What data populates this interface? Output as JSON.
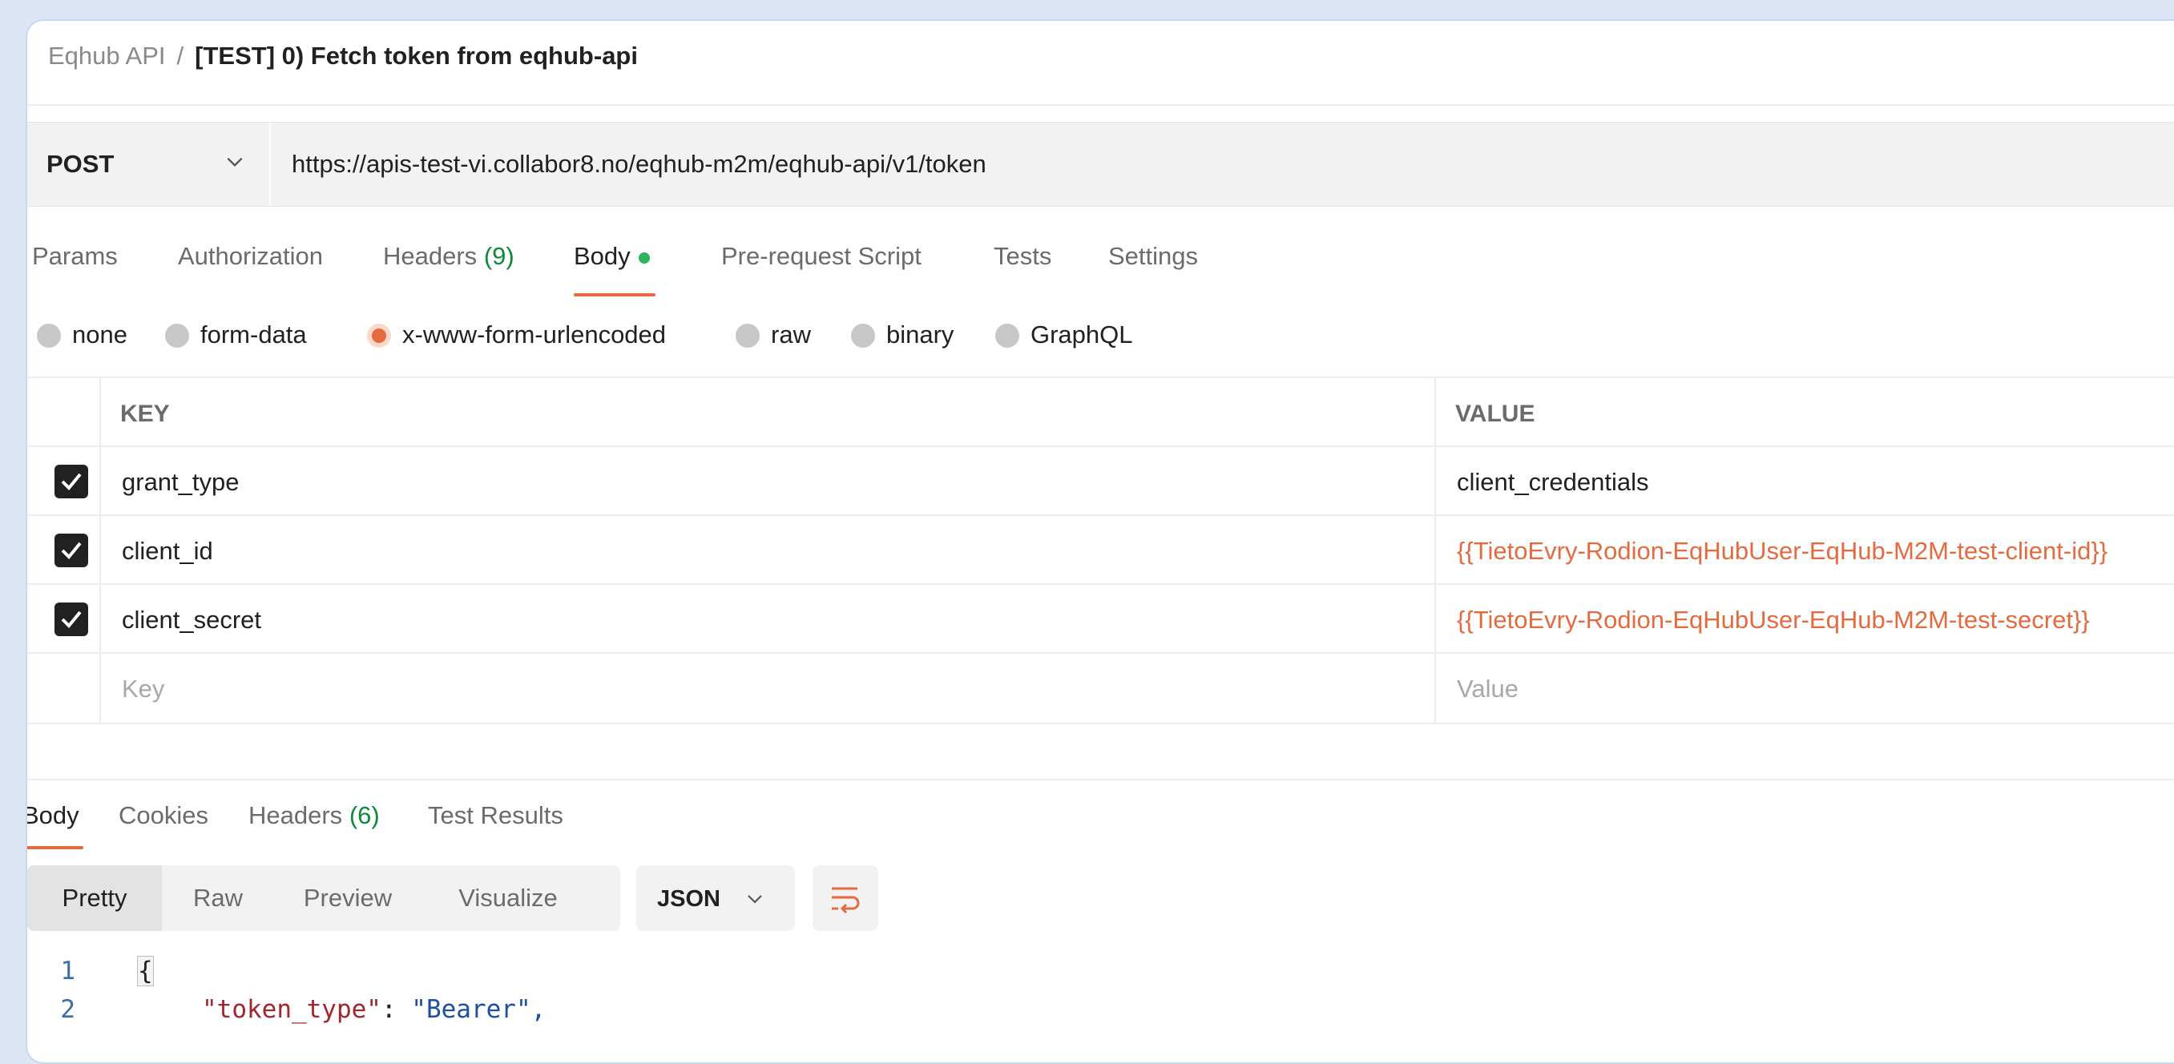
{
  "breadcrumb": {
    "parent": "Eqhub API",
    "separator": "/",
    "current": "[TEST] 0) Fetch token from eqhub-api"
  },
  "request": {
    "method": "POST",
    "url": "https://apis-test-vi.collabor8.no/eqhub-m2m/eqhub-api/v1/token"
  },
  "request_tabs": {
    "params": "Params",
    "authorization": "Authorization",
    "headers": "Headers",
    "headers_count": "(9)",
    "body": "Body",
    "prerequest": "Pre-request Script",
    "tests": "Tests",
    "settings": "Settings",
    "active": "Body"
  },
  "body_types": {
    "none": "none",
    "form_data": "form-data",
    "urlencoded": "x-www-form-urlencoded",
    "raw": "raw",
    "binary": "binary",
    "graphql": "GraphQL",
    "selected": "x-www-form-urlencoded"
  },
  "params_table": {
    "key_header": "KEY",
    "value_header": "VALUE",
    "rows": [
      {
        "checked": true,
        "key": "grant_type",
        "value": "client_credentials"
      },
      {
        "checked": true,
        "key": "client_id",
        "value": "{{TietoEvry-Rodion-EqHubUser-EqHub-M2M-test-client-id}}"
      },
      {
        "checked": true,
        "key": "client_secret",
        "value": "{{TietoEvry-Rodion-EqHubUser-EqHub-M2M-test-secret}}"
      }
    ],
    "key_placeholder": "Key",
    "value_placeholder": "Value"
  },
  "response_tabs": {
    "body": "Body",
    "cookies": "Cookies",
    "headers": "Headers",
    "headers_count": "(6)",
    "test_results": "Test Results",
    "active": "Body"
  },
  "view_modes": {
    "pretty": "Pretty",
    "raw": "Raw",
    "preview": "Preview",
    "visualize": "Visualize",
    "active": "Pretty"
  },
  "format_select": "JSON",
  "code": {
    "line1_no": "1",
    "line1": "{",
    "line2_no": "2",
    "line2_key": "\"token_type\"",
    "line2_sep": ": ",
    "line2_val": "\"Bearer\","
  },
  "colors": {
    "accent": "#e46a3f",
    "success": "#2db55d",
    "count_green": "#0c8a3a"
  },
  "icons": [
    "chevron-down-icon",
    "checkbox-checked-icon",
    "wrap-lines-icon"
  ]
}
